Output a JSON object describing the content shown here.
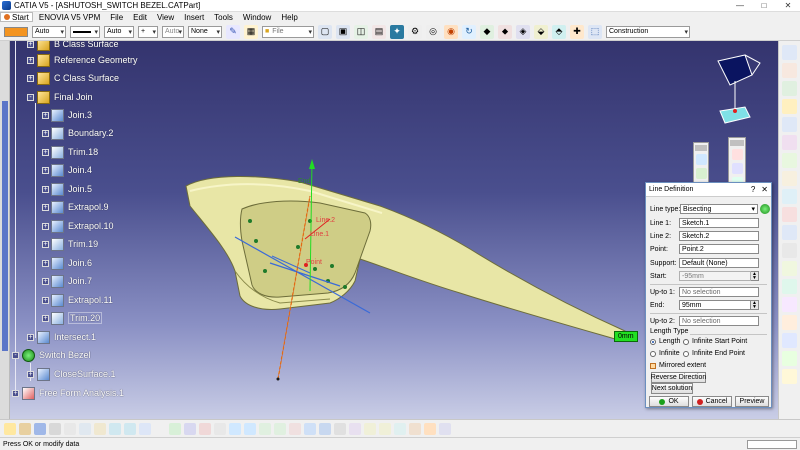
{
  "window": {
    "title": "CATIA V5 - [ASHUTOSH_SWITCH BEZEL.CATPart]",
    "minimize": "—",
    "maximize": "□",
    "close": "✕"
  },
  "menu": {
    "start": "Start",
    "items": [
      "ENOVIA V5 VPM",
      "File",
      "Edit",
      "View",
      "Insert",
      "Tools",
      "Window",
      "Help"
    ]
  },
  "toolbar": {
    "linetype_1": "Auto",
    "linetype_2": "Auto",
    "linetype_3": "Auto",
    "none": "None",
    "file_label": "File",
    "construction": "Construction",
    "colors": {
      "orange": "#f39420"
    }
  },
  "tree": {
    "items": [
      {
        "label": "B Class Surface"
      },
      {
        "label": "Reference Geometry"
      },
      {
        "label": "C Class Surface"
      },
      {
        "label": "Final Join"
      },
      {
        "label": "Join.3"
      },
      {
        "label": "Boundary.2"
      },
      {
        "label": "Trim.18"
      },
      {
        "label": "Join.4"
      },
      {
        "label": "Join.5"
      },
      {
        "label": "Extrapol.9"
      },
      {
        "label": "Extrapol.10"
      },
      {
        "label": "Trim.19"
      },
      {
        "label": "Join.6"
      },
      {
        "label": "Join.7"
      },
      {
        "label": "Extrapol.11"
      },
      {
        "label": "Trim.20"
      },
      {
        "label": "Intersect.1"
      },
      {
        "label": "Switch Bezel"
      },
      {
        "label": "CloseSurface.1"
      },
      {
        "label": "Free Form Analysis.1"
      }
    ]
  },
  "viewport": {
    "labels": {
      "end": "End",
      "line1": "Line.1",
      "line2": "Line.2",
      "point": "Point"
    },
    "dimension": "0mm"
  },
  "dialog": {
    "title": "Line Definition",
    "help": "?",
    "close": "✕",
    "line_type_label": "Line type:",
    "line_type_value": "Bisecting",
    "line1_label": "Line 1:",
    "line1_value": "Sketch.1",
    "line2_label": "Line 2:",
    "line2_value": "Sketch.2",
    "point_label": "Point:",
    "point_value": "Point.2",
    "support_label": "Support:",
    "support_value": "Default (None)",
    "start_label": "Start:",
    "start_value": "-95mm",
    "upto1_label": "Up-to 1:",
    "upto1_value": "No selection",
    "end_label": "End:",
    "end_value": "95mm",
    "upto2_label": "Up-to 2:",
    "upto2_value": "No selection",
    "length_type_label": "Length Type",
    "opt_length": "Length",
    "opt_infinite_start": "Infinite Start Point",
    "opt_infinite": "Infinite",
    "opt_infinite_end": "Infinite End Point",
    "mirrored": "Mirrored extent",
    "reverse": "Reverse Direction",
    "next": "Next solution",
    "ok": "OK",
    "cancel": "Cancel",
    "preview": "Preview"
  },
  "status": {
    "message": "Press OK or modify data"
  }
}
